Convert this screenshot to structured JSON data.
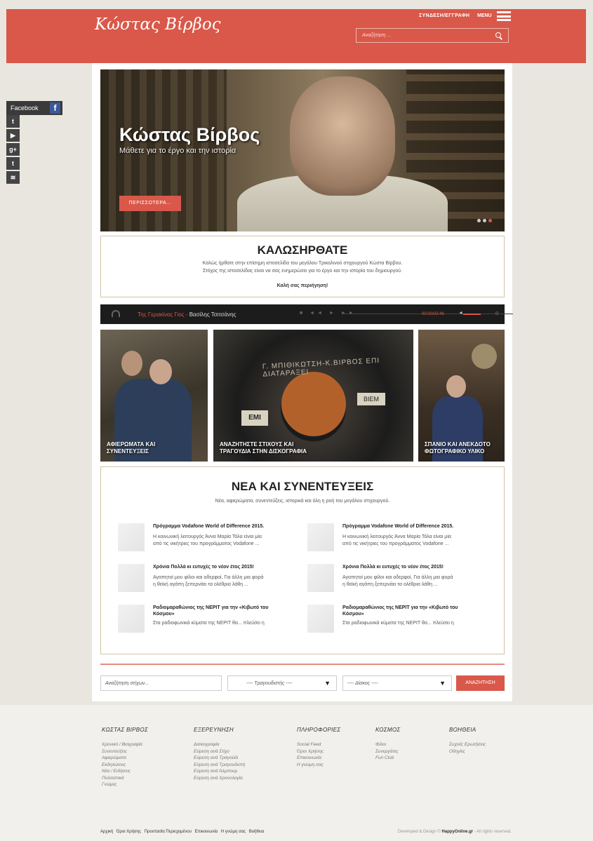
{
  "header": {
    "logo": "Κώστας Βίρβος",
    "login": "ΣΥΝΔΕΣΗ/ΕΓΓΡΑΦΗ",
    "menu": "MENU",
    "search_placeholder": "Αναζήτηση ..."
  },
  "social": {
    "facebook": "Facebook",
    "fb_glyph": "f",
    "items": [
      {
        "icon": "twitter-icon",
        "glyph": "t"
      },
      {
        "icon": "youtube-icon",
        "glyph": "▶"
      },
      {
        "icon": "googleplus-icon",
        "glyph": "g+"
      },
      {
        "icon": "tumblr-icon",
        "glyph": "t"
      },
      {
        "icon": "rss-icon",
        "glyph": "≋"
      }
    ]
  },
  "hero": {
    "title": "Κώστας Βίρβος",
    "subtitle": "Μάθετε για το έργο και την ιστορία",
    "button": "ΠΕΡΙΣΣΟΤΕΡΑ..."
  },
  "welcome": {
    "title": "ΚΑΛΩΣΗΡΘΑΤΕ",
    "line1": "Καλώς ήρθατε στην επίσημη ιστοσελίδα του μεγάλου Τρικαλινού στιχουργού Κώστα Βίρβου.",
    "line2": "Στόχος της ιστοσελίδας είναι να σας ενημερώσει για το έργο και την ιστορία του δημιουργού.",
    "line3": "Καλή σας περιήγηση!"
  },
  "player": {
    "song": "Της Γερακίνας Γιος",
    "sep": " - ",
    "artist": "Βασίλης Τσιτσάνης",
    "time": "00:00/02:46",
    "controls": "■ ◄◄ ► ►►",
    "vol_icon": "◄",
    "gear": "⚙"
  },
  "tiles": [
    {
      "line1": "ΑΦΙΕΡΩΜΑΤΑ ΚΑΙ",
      "line2": "ΣΥΝΕΝΤΕΥΞΕΙΣ"
    },
    {
      "line1": "ΑΝΑΖΗΤΗΣΤΕ ΣΤΙΧΟΥΣ ΚΑΙ",
      "line2": "ΤΡΑΓΟΥΔΙΑ ΣΤΗΝ ΔΙΣΚΟΓΡΑΦΙΑ",
      "record_text": "Γ. ΜΠΙΘΙΚΩΤΣΗ-Κ.ΒΙΡΒΟΣ ΕΠΙ ΔΙΑΤΑΡΑΞΕΙ",
      "label1": "EMI",
      "label2": "ΒΙΕΜ"
    },
    {
      "line1": "ΣΠΑΝΙΟ ΚΑΙ ΑΝΕΚΔΟΤΟ",
      "line2": "ΦΩΤΟΓΡΑΦΙΚΟ ΥΛΙΚΟ"
    }
  ],
  "news": {
    "title": "ΝΕΑ ΚΑΙ ΣΥΝΕΝΤΕΥΞΕΙΣ",
    "subtitle": "Νέα, αφιερώματα, συνεντεύξεις, ιστορικά και όλη η ροή του μεγάλου στιχουργού.",
    "items": [
      {
        "title": "Πρόγραμμα Vodafone World of Difference 2015.",
        "line1": "Η κοινωνική λειτουργός Άννα Μαρία Τόλα είναι μία",
        "line2": "από τις νικήτριες του προγράμματος Vodafone ..."
      },
      {
        "title": "Πρόγραμμα Vodafone World of Difference 2015.",
        "line1": "Η κοινωνική λειτουργός Άννα Μαρία Τόλα είναι μία",
        "line2": "από τις νικήτριες του προγράμματος Vodafone ..."
      },
      {
        "title": "Χρόνια Πολλά κι ευτυχές το νέον έτος 2015!",
        "line1": "Αγαπητοί μου φίλοι και αδερφοί, Για άλλη μια φορά",
        "line2": "η θεϊκή αγάπη ξεπερνάει τα ολέθρια λάθη ..."
      },
      {
        "title": "Χρόνια Πολλά κι ευτυχές το νέον έτος 2015!",
        "line1": "Αγαπητοί μου φίλοι και αδερφοί, Για άλλη μια φορά",
        "line2": "η θεϊκή αγάπη ξεπερνάει τα ολέθρια λάθη ..."
      },
      {
        "title": "Ραδιομαραθώνιος της ΝΕΡΙΤ για την «Κιβωτό του Κόσμου»",
        "line1": "Στα ραδιοφωνικά κύματα της ΝΕΡΙΤ θα... πλεύσει η",
        "line2": ""
      },
      {
        "title": "Ραδιομαραθώνιος της ΝΕΡΙΤ για την «Κιβωτό του Κόσμου»",
        "line1": "Στα ραδιοφωνικά κύματα της ΝΕΡΙΤ θα... πλεύσει η",
        "line2": ""
      }
    ]
  },
  "lyrics_search": {
    "input": "Αναζήτηση στίχων...",
    "singer": "---- Τραγουδιστής ----",
    "disc": "---- Δίσκος ----",
    "arrow": "▼",
    "button": "ΑΝΑΖΗΤΗΣΗ"
  },
  "footer": {
    "columns": [
      {
        "title": "ΚΩΣΤΑΣ ΒΙΡΒΟΣ",
        "links": [
          "Χρονικό / Βιογραφία",
          "Συνεντεύξεις",
          "Αφιερώματα",
          "Εκδηλώσεις",
          "Νέα / Ειδήσεις",
          "Πολιτιστικά",
          "Γνώμες"
        ]
      },
      {
        "title": "ΕΞΕΡΕΥΝΗΣΗ",
        "links": [
          "Δισκογραφία",
          "Εύρεση ανά Στίχο",
          "Εύρεση ανά Τραγούδι",
          "Εύρεση ανά Τραγουδιστή",
          "Εύρεση ανά Άλμπουμ",
          "Εύρεση ανά Χρονολογία"
        ]
      },
      {
        "title": "ΠΛΗΡΟΦΟΡΙΕΣ",
        "links": [
          "Social Feed",
          "Όροι Χρήσης",
          "Επικοινωνία",
          "Η γνώμη σας"
        ]
      },
      {
        "title": "ΚΟΣΜΟΣ",
        "links": [
          "Φίλοι",
          "Συνεργάτες",
          "Fun Club"
        ]
      },
      {
        "title": "ΒΟΗΘΕΙΑ",
        "links": [
          "Συχνές Ερωτήσεις",
          "Οδηγίες"
        ]
      }
    ],
    "bottom_links": [
      "Αρχική",
      "Όροι Χρήσης",
      "Προστασία Περιεχομένου",
      "Επικοινωνία",
      "Η γνώμη σας",
      "Βοήθεια"
    ],
    "copy_pre": "Developed & Design © ",
    "copy_brand": "HappyOnline.gr",
    "copy_post": " - All rights reserved."
  },
  "colors": {
    "accent": "#d9584a",
    "dark": "#1c1c1c",
    "border": "#d4c3a8"
  }
}
